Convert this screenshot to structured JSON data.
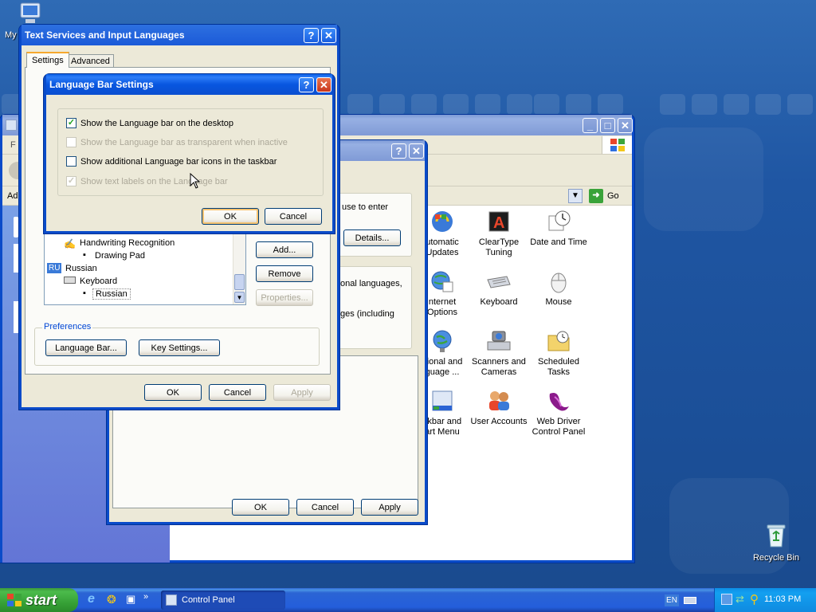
{
  "desktop": {
    "icons": [
      {
        "label": "My",
        "icon": "my-computer-icon"
      },
      {
        "label": "Recycle Bin",
        "icon": "recycle-bin-icon"
      }
    ]
  },
  "control_panel": {
    "go_label": "Go",
    "partial_left_labels": [
      "F",
      "Ad"
    ],
    "items": [
      {
        "label": "utomatic\nUpdates",
        "icon": "automatic-updates-icon"
      },
      {
        "label": "ClearType\nTuning",
        "icon": "cleartype-icon"
      },
      {
        "label": "Date and Time",
        "icon": "date-time-icon"
      },
      {
        "label": "nternet\nOptions",
        "icon": "internet-options-icon"
      },
      {
        "label": "Keyboard",
        "icon": "keyboard-icon"
      },
      {
        "label": "Mouse",
        "icon": "mouse-icon"
      },
      {
        "label": "gional and\nguage ...",
        "icon": "regional-language-icon"
      },
      {
        "label": "Scanners and\nCameras",
        "icon": "scanners-cameras-icon"
      },
      {
        "label": "Scheduled\nTasks",
        "icon": "scheduled-tasks-icon"
      },
      {
        "label": "skbar and\nart Menu",
        "icon": "taskbar-start-menu-icon"
      },
      {
        "label": "User Accounts",
        "icon": "user-accounts-icon"
      },
      {
        "label": "Web Driver\nControl Panel",
        "icon": "web-driver-icon"
      }
    ]
  },
  "regional_dialog": {
    "text1": "use to enter",
    "details_label": "Details...",
    "text2": "onal languages,",
    "text3": "ges (including",
    "ok_label": "OK",
    "cancel_label": "Cancel",
    "apply_label": "Apply"
  },
  "text_services": {
    "title": "Text Services and Input Languages",
    "tabs": [
      "Settings",
      "Advanced"
    ],
    "tree": {
      "handwriting": "Handwriting Recognition",
      "drawing_pad": "Drawing Pad",
      "ru_badge": "RU",
      "russian": "Russian",
      "keyboard": "Keyboard",
      "russian_layout": "Russian"
    },
    "add_label": "Add...",
    "remove_label": "Remove",
    "properties_label": "Properties...",
    "preferences_label": "Preferences",
    "language_bar_label": "Language Bar...",
    "key_settings_label": "Key Settings...",
    "ok_label": "OK",
    "cancel_label": "Cancel",
    "apply_label": "Apply"
  },
  "language_bar_settings": {
    "title": "Language Bar Settings",
    "options": [
      {
        "label": "Show the Language bar on the desktop",
        "checked": true,
        "enabled": true
      },
      {
        "label": "Show the Language bar as transparent when inactive",
        "checked": false,
        "enabled": false
      },
      {
        "label": "Show additional Language bar icons in the taskbar",
        "checked": false,
        "enabled": true
      },
      {
        "label": "Show text labels on the Language bar",
        "checked": true,
        "enabled": false
      }
    ],
    "ok_label": "OK",
    "cancel_label": "Cancel"
  },
  "taskbar": {
    "start_label": "start",
    "task_label": "Control Panel",
    "lang_indicator": "EN",
    "clock": "11:03 PM"
  }
}
